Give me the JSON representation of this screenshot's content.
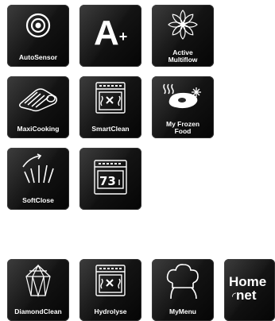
{
  "features": [
    {
      "name": "AutoSensor",
      "lines": [
        "AutoSensor"
      ],
      "icon": "autosensor-icon"
    },
    {
      "name": "A+",
      "lines": [],
      "icon": "energy-class-icon",
      "glyph": "A",
      "sup": "+"
    },
    {
      "name": "Active Multiflow",
      "lines": [
        "Active",
        "Multiflow"
      ],
      "icon": "multiflow-fan-icon"
    },
    {
      "name": "MaxiCooking",
      "lines": [
        "MaxiCooking"
      ],
      "icon": "maxicooking-icon"
    },
    {
      "name": "SmartClean",
      "lines": [
        "SmartClean"
      ],
      "icon": "smartclean-oven-icon"
    },
    {
      "name": "My Frozen Food",
      "lines": [
        "My Frozen",
        "Food"
      ],
      "icon": "frozen-food-icon"
    },
    {
      "name": "SoftClose",
      "lines": [
        "SoftClose"
      ],
      "icon": "softclose-icon"
    },
    {
      "name": "Timer display",
      "lines": [],
      "icon": "oven-display-icon",
      "display": "73"
    },
    {
      "name": "DiamondClean",
      "lines": [
        "DiamondClean"
      ],
      "icon": "diamond-icon"
    },
    {
      "name": "Hydrolyse",
      "lines": [
        "Hydrolyse"
      ],
      "icon": "hydrolyse-oven-icon"
    },
    {
      "name": "MyMenu",
      "lines": [
        "MyMenu"
      ],
      "icon": "chef-hat-icon"
    },
    {
      "name": "Home+net",
      "lines": [],
      "icon": "homenet-logo",
      "logo": [
        "Home",
        "net"
      ]
    }
  ]
}
